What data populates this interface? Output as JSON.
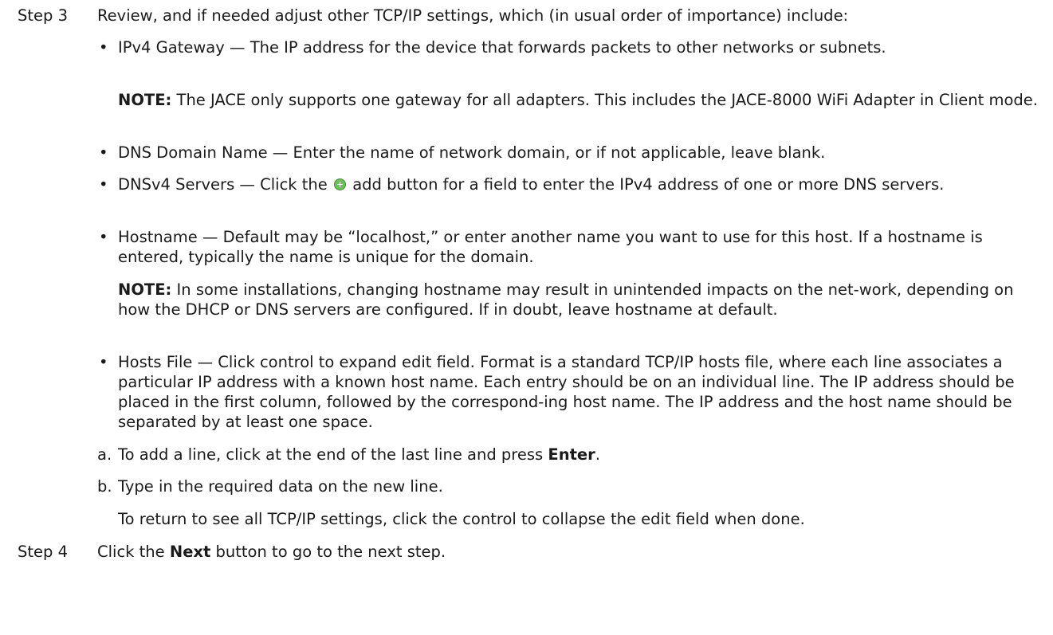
{
  "step3": {
    "label": "Step 3",
    "text": "Review, and if needed adjust other TCP/IP settings, which (in usual order of importance) include:"
  },
  "bullets": {
    "marker": "•",
    "gateway": {
      "text": "IPv4 Gateway — The IP address for the device that forwards packets to other networks or subnets."
    },
    "gateway_note": {
      "label": "NOTE:",
      "text": "The JACE only supports one gateway for all adapters. This includes the JACE-8000 WiFi Adapter in Client mode."
    },
    "domain": {
      "text": "DNS Domain Name —  Enter the name of network domain, or if not applicable, leave blank."
    },
    "dns_servers": {
      "before": "DNSv4 Servers —  Click the",
      "after": "add button for a field to enter the IPv4 address of one or more DNS servers.",
      "icon": "add-icon"
    },
    "hostname": {
      "text": "Hostname — Default may be “localhost,” or enter another name you want to use for this host. If a hostname is entered, typically the name is unique for the domain."
    },
    "hostname_note": {
      "label": "NOTE:",
      "text": "In some installations, changing hostname may result in unintended impacts on the net-work, depending on how the DHCP or DNS servers are configured. If in doubt, leave hostname at default."
    },
    "hosts_file": {
      "text": "Hosts File — Click control to expand edit field. Format is a standard TCP/IP hosts file, where each line associates a particular IP address with a known host name. Each entry should be on an individual line. The IP address should be placed in the first column, followed by the correspond-ing host name. The IP address and the host name should be separated by at least one space."
    }
  },
  "substeps": {
    "a": {
      "letter": "a.",
      "before": "To add a line, click at the end of the last line and press",
      "key": "Enter",
      "after": "."
    },
    "b": {
      "letter": "b.",
      "text": "Type in the required data on the new line."
    },
    "followup": "To return to see all TCP/IP settings, click the control to collapse the edit field when done."
  },
  "step4": {
    "label": "Step 4",
    "before": "Click the",
    "button": "Next",
    "after": "button to go to the next step."
  },
  "colors": {
    "text": "#1a1a1a",
    "add_icon": "#6cc05a"
  }
}
